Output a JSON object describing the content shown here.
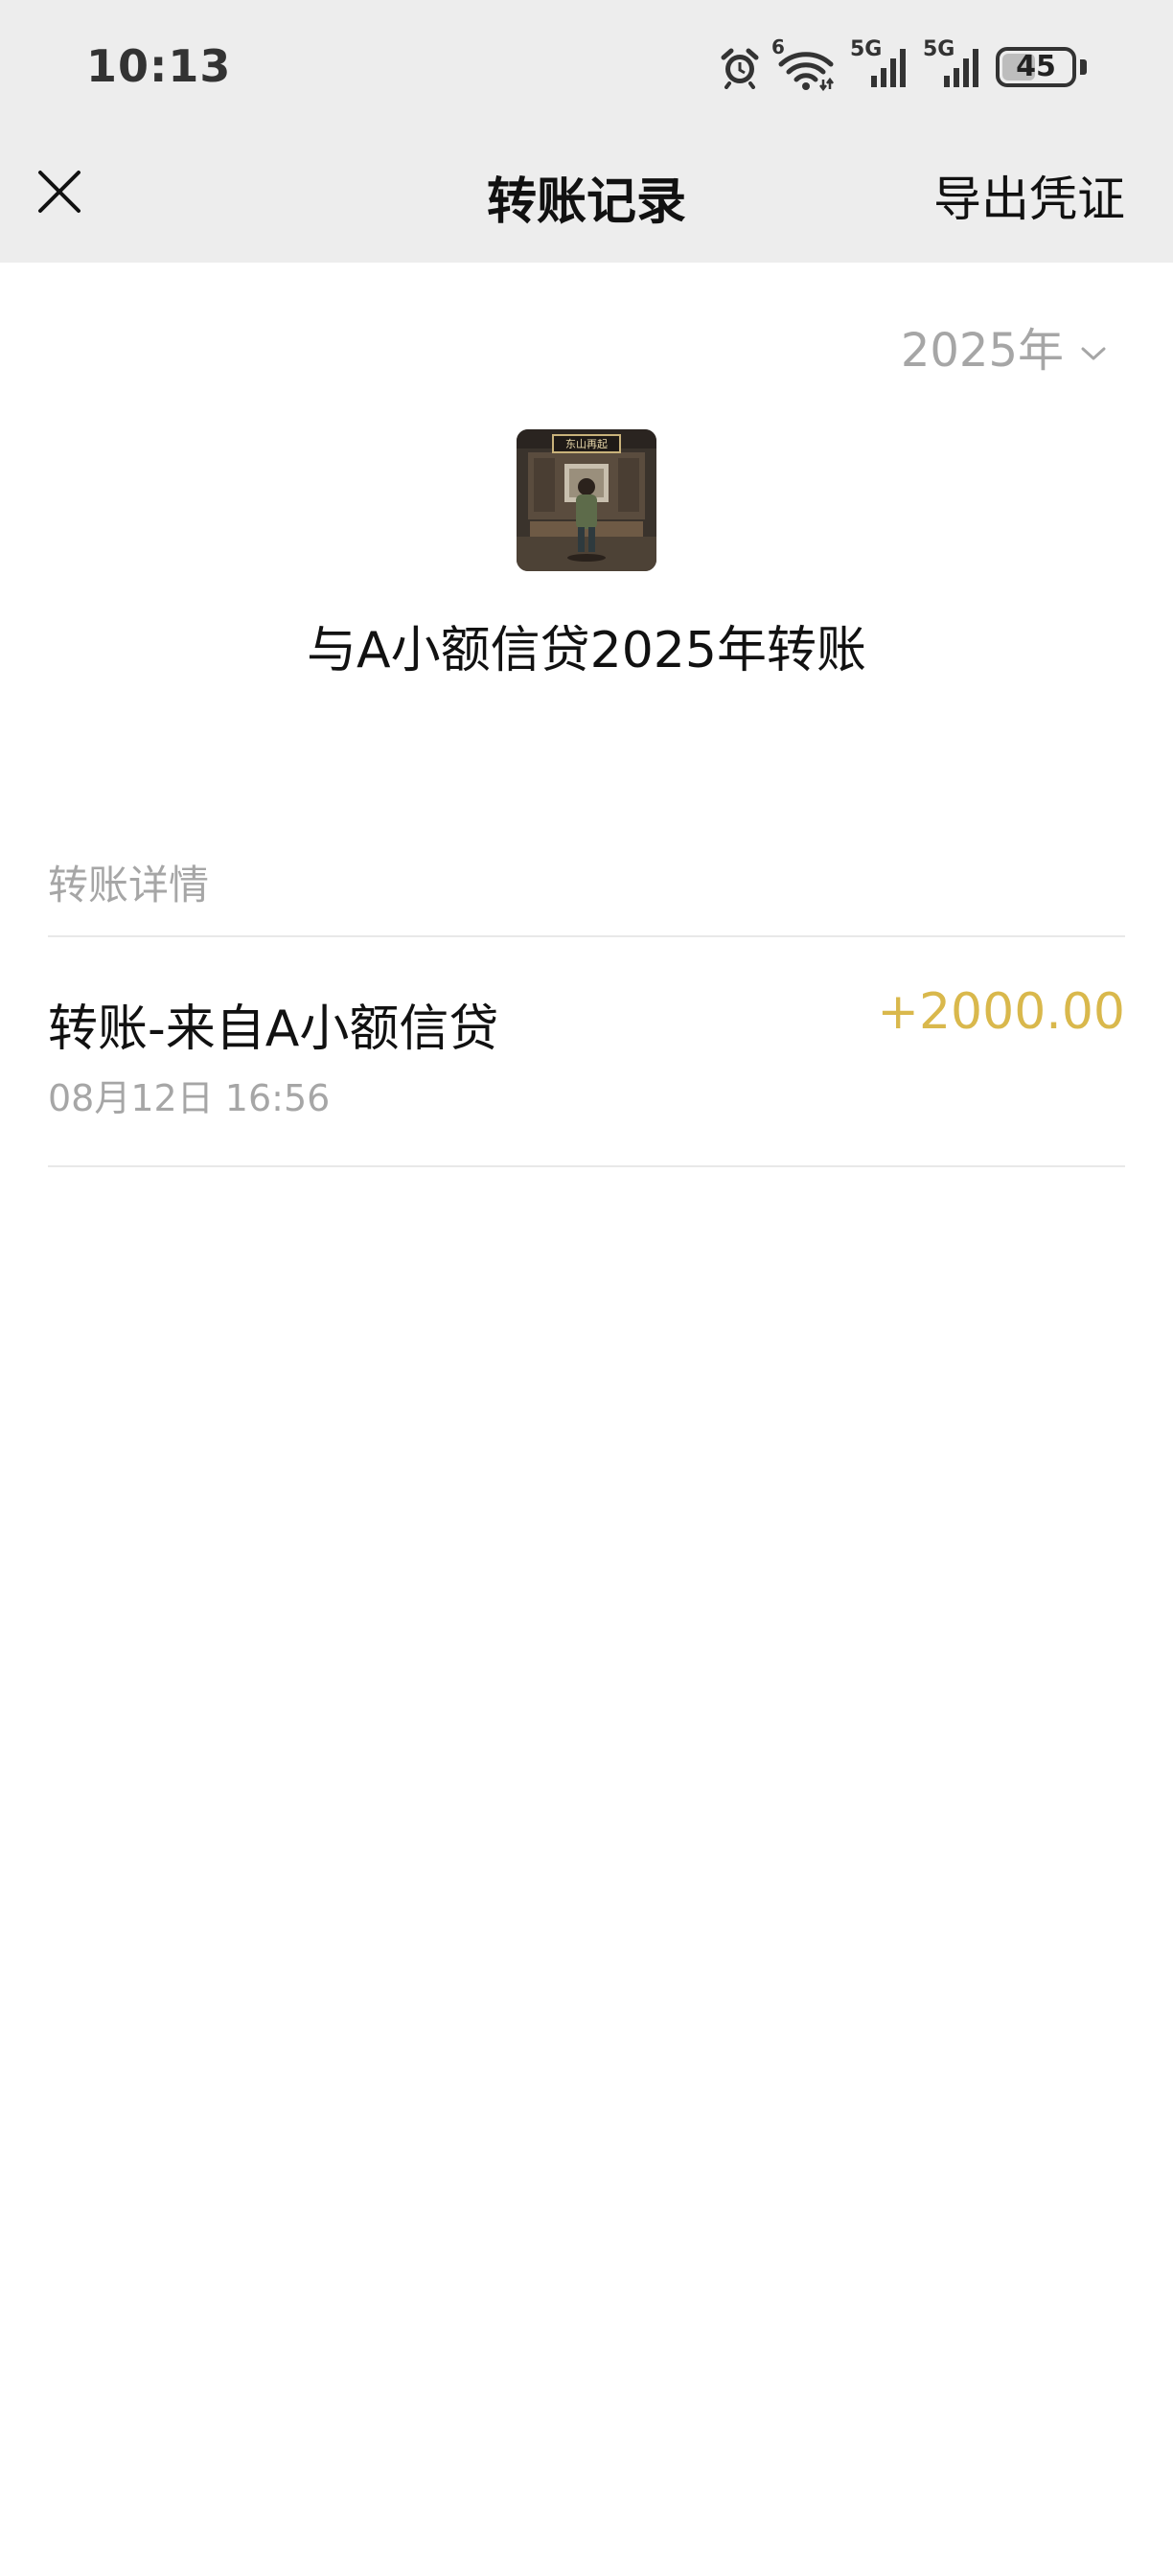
{
  "status_bar": {
    "time": "10:13",
    "icons": [
      "alarm-icon",
      "wifi-icon",
      "signal-5g-icon",
      "signal-5g-icon",
      "battery-icon"
    ],
    "wifi_tag": "6",
    "network_1": "5G",
    "network_2": "5G",
    "battery_percent": "45",
    "battery_level": 0.45
  },
  "nav": {
    "close_icon": "close-icon",
    "title": "转账记录",
    "action_label": "导出凭证"
  },
  "filter": {
    "year_label": "2025年",
    "chevron_icon": "chevron-down-icon"
  },
  "header": {
    "avatar_icon": "contact-avatar",
    "avatar_sign": "东山再起",
    "title": "与A小额信贷2025年转账"
  },
  "details": {
    "section_label": "转账详情",
    "items": [
      {
        "title": "转账-来自A小额信贷",
        "time": "08月12日 16:56",
        "amount": "+2000.00"
      }
    ]
  },
  "colors": {
    "nav_background": "#ededed",
    "amount_income": "#d9b84c",
    "secondary_text": "#a6a6a6",
    "divider": "#e8e8e8"
  }
}
